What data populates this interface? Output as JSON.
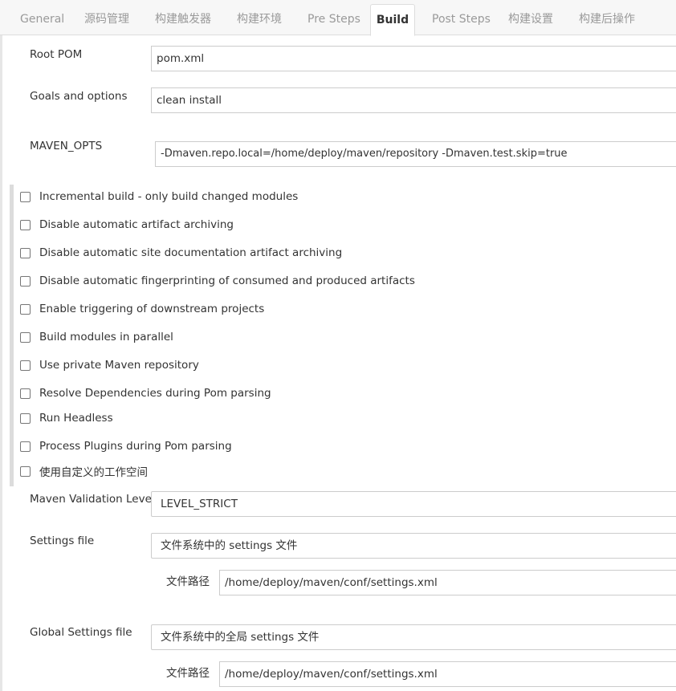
{
  "tabs": [
    {
      "label": "General",
      "active": false
    },
    {
      "label": "源码管理",
      "active": false
    },
    {
      "label": "构建触发器",
      "active": false
    },
    {
      "label": "构建环境",
      "active": false
    },
    {
      "label": "Pre Steps",
      "active": false
    },
    {
      "label": "Build",
      "active": true
    },
    {
      "label": "Post Steps",
      "active": false
    },
    {
      "label": "构建设置",
      "active": false
    },
    {
      "label": "构建后操作",
      "active": false
    }
  ],
  "build": {
    "root_pom": {
      "label": "Root POM",
      "value": "pom.xml"
    },
    "goals": {
      "label": "Goals and options",
      "value": "clean install"
    },
    "maven_opts": {
      "label": "MAVEN_OPTS",
      "value": "-Dmaven.repo.local=/home/deploy/maven/repository -Dmaven.test.skip=true"
    },
    "checkboxes": [
      {
        "label": "Incremental build - only build changed modules",
        "checked": false
      },
      {
        "label": "Disable automatic artifact archiving",
        "checked": false
      },
      {
        "label": "Disable automatic site documentation artifact archiving",
        "checked": false
      },
      {
        "label": "Disable automatic fingerprinting of consumed and produced artifacts",
        "checked": false
      },
      {
        "label": "Enable triggering of downstream projects",
        "checked": false
      },
      {
        "label": "Build modules in parallel",
        "checked": false
      },
      {
        "label": "Use private Maven repository",
        "checked": false
      },
      {
        "label": "Resolve Dependencies during Pom parsing",
        "checked": false
      },
      {
        "label": "Run Headless",
        "checked": false
      },
      {
        "label": "Process Plugins during Pom parsing",
        "checked": false
      },
      {
        "label": "使用自定义的工作空间",
        "checked": false
      }
    ],
    "validation_level": {
      "label": "Maven Validation Level",
      "value": "LEVEL_STRICT"
    },
    "settings_file": {
      "label": "Settings file",
      "value": "文件系统中的 settings 文件",
      "path_label": "文件路径",
      "path_value": "/home/deploy/maven/conf/settings.xml"
    },
    "global_settings_file": {
      "label": "Global Settings file",
      "value": "文件系统中的全局 settings 文件",
      "path_label": "文件路径",
      "path_value": "/home/deploy/maven/conf/settings.xml"
    }
  }
}
